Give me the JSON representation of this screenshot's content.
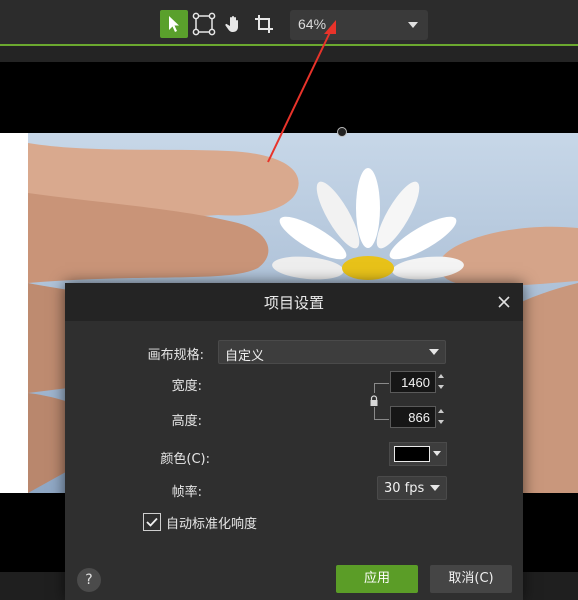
{
  "toolbar": {
    "tools": [
      {
        "name": "pointer-tool",
        "icon": "cursor-icon",
        "active": true
      },
      {
        "name": "transform-tool",
        "icon": "crop-frame-icon",
        "active": false
      },
      {
        "name": "pan-tool",
        "icon": "hand-icon",
        "active": false
      },
      {
        "name": "crop-tool",
        "icon": "crop-icon",
        "active": false
      }
    ],
    "zoom": "64%",
    "accent_color": "#5aa02c"
  },
  "dialog": {
    "title": "项目设置",
    "canvas_size_label": "画布规格:",
    "canvas_size_value": "自定义",
    "width_label": "宽度:",
    "width_value": "1460",
    "height_label": "高度:",
    "height_value": "866",
    "color_label": "颜色(C):",
    "color_value": "#000000",
    "fps_label": "帧率:",
    "fps_value": "30 fps",
    "auto_normalize_label": "自动标准化响度",
    "auto_normalize_checked": true,
    "help_label": "?",
    "apply_label": "应用",
    "cancel_label": "取消(C)"
  }
}
